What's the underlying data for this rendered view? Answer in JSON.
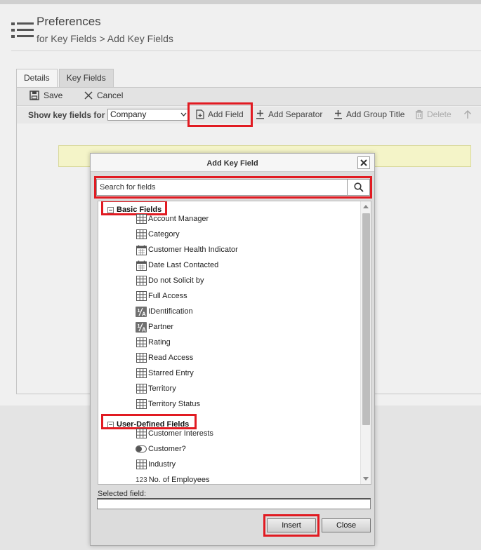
{
  "page": {
    "title": "Preferences",
    "subtitle": "for Key Fields > Add Key Fields",
    "icon": "list-menu-icon"
  },
  "tabs": [
    {
      "label": "Details",
      "active": false
    },
    {
      "label": "Key Fields",
      "active": true
    }
  ],
  "toolbar": {
    "save_label": "Save",
    "cancel_label": "Cancel"
  },
  "subbar": {
    "show_label": "Show key fields for",
    "select_value": "Company",
    "add_field_label": "Add Field",
    "add_separator_label": "Add Separator",
    "add_group_title_label": "Add Group Title",
    "delete_label": "Delete"
  },
  "dialog": {
    "title": "Add Key Field",
    "search_placeholder": "Search for fields",
    "groups": [
      {
        "label": "Basic Fields",
        "items": [
          {
            "label": "Account Manager",
            "icon": "grid-icon"
          },
          {
            "label": "Category",
            "icon": "grid-icon"
          },
          {
            "label": "Customer Health Indicator",
            "icon": "calendar-icon"
          },
          {
            "label": "Date Last Contacted",
            "icon": "calendar-icon"
          },
          {
            "label": "Do not Solicit by",
            "icon": "grid-icon"
          },
          {
            "label": "Full Access",
            "icon": "grid-icon"
          },
          {
            "label": "IDentification",
            "icon": "text-field-icon"
          },
          {
            "label": "Partner",
            "icon": "text-field-icon"
          },
          {
            "label": "Rating",
            "icon": "grid-icon"
          },
          {
            "label": "Read Access",
            "icon": "grid-icon"
          },
          {
            "label": "Starred Entry",
            "icon": "grid-icon"
          },
          {
            "label": "Territory",
            "icon": "grid-icon"
          },
          {
            "label": "Territory Status",
            "icon": "grid-icon"
          }
        ]
      },
      {
        "label": "User-Defined Fields",
        "items": [
          {
            "label": "Customer Interests",
            "icon": "grid-icon"
          },
          {
            "label": "Customer?",
            "icon": "toggle-icon"
          },
          {
            "label": "Industry",
            "icon": "grid-icon"
          },
          {
            "label": "No. of Employees",
            "icon": "number-icon",
            "icon_text": "123"
          }
        ]
      }
    ],
    "selected_field_label": "Selected field:",
    "selected_field_value": "",
    "insert_label": "Insert",
    "close_label": "Close"
  },
  "colors": {
    "highlight": "#e11b22",
    "notice_bg": "#f4f4c8"
  }
}
